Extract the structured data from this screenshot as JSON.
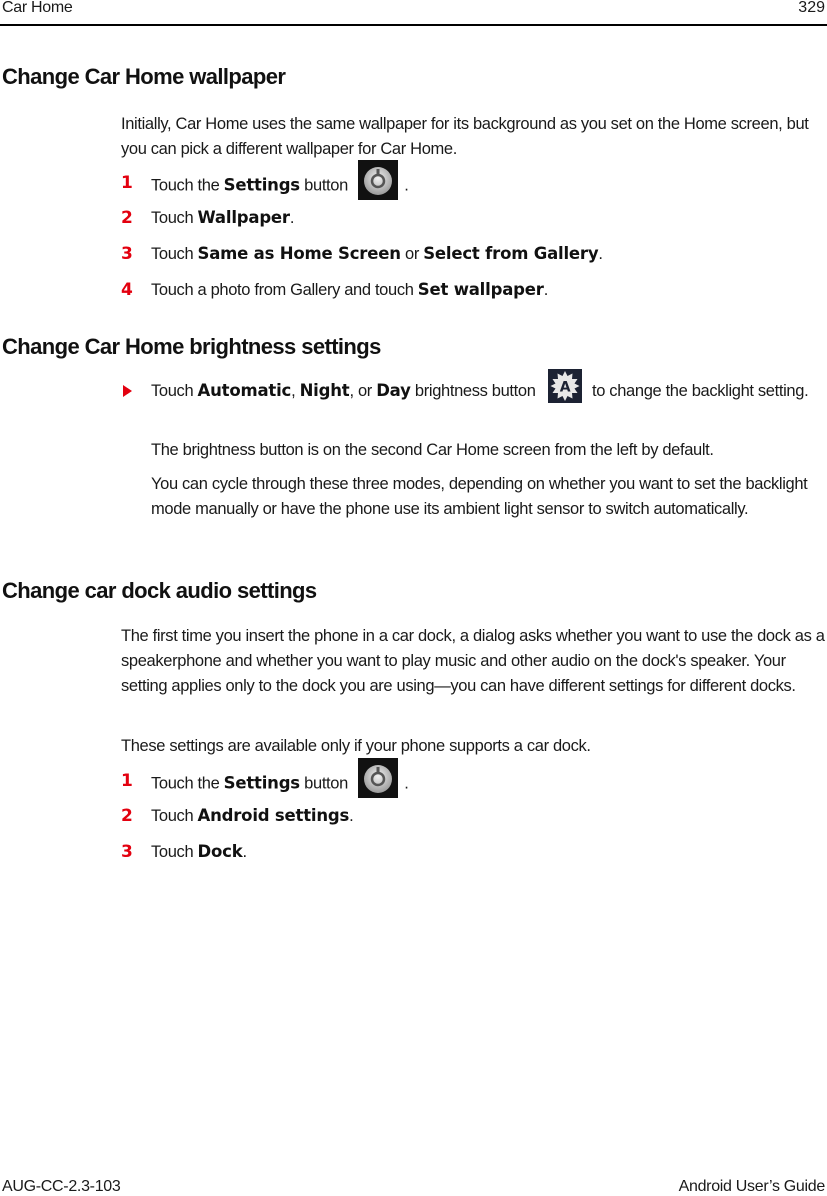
{
  "header": {
    "section": "Car Home",
    "page_number": "329"
  },
  "sections": [
    {
      "title": "Change Car Home wallpaper",
      "intro": "Initially, Car Home uses the same wallpaper for its background as you set on the Home screen, but you can pick a different wallpaper for Car Home.",
      "steps": [
        {
          "num": "1",
          "pre": "Touch the ",
          "bold1": "Settings",
          "post": " button",
          "icon": "settings-icon",
          "end": "."
        },
        {
          "num": "2",
          "pre": "Touch ",
          "bold1": "Wallpaper",
          "end": "."
        },
        {
          "num": "3",
          "pre": "Touch ",
          "bold1": "Same as Home Screen",
          "mid": " or ",
          "bold2": "Select from Gallery",
          "end": "."
        },
        {
          "num": "4",
          "pre": "Touch a photo from Gallery and touch ",
          "bold1": "Set wallpaper",
          "end": "."
        }
      ]
    },
    {
      "title": "Change Car Home brightness settings",
      "bullet": {
        "pre": "Touch ",
        "bold1": "Automatic",
        "sep1": ", ",
        "bold2": "Night",
        "sep2": ", or ",
        "bold3": "Day",
        "post": " brightness button",
        "icon": "brightness-auto-icon",
        "end": " to change the backlight setting."
      },
      "notes": [
        "The brightness button is on the second Car Home screen from the left by default.",
        "You can cycle through these three modes, depending on whether you want to set the backlight mode manually or have the phone use its ambient light sensor to switch automatically."
      ]
    },
    {
      "title": "Change car dock audio settings",
      "intro": "The first time you insert the phone in a car dock, a dialog asks whether you want to use the dock as a speakerphone and whether you want to play music and other audio on the dock's speaker. Your setting applies only to the dock you are using—you can have different settings for different docks.",
      "note": "These settings are available only if your phone supports a car dock.",
      "steps": [
        {
          "num": "1",
          "pre": "Touch the ",
          "bold1": "Settings",
          "post": " button",
          "icon": "settings-icon",
          "end": "."
        },
        {
          "num": "2",
          "pre": "Touch ",
          "bold1": "Android settings",
          "end": "."
        },
        {
          "num": "3",
          "pre": "Touch ",
          "bold1": "Dock",
          "end": "."
        }
      ]
    }
  ],
  "footer": {
    "doc_id": "AUG-CC-2.3-103",
    "guide_title": "Android User’s Guide"
  },
  "colors": {
    "step_number": "#e3000f",
    "bullet_arrow": "#e3000f"
  }
}
